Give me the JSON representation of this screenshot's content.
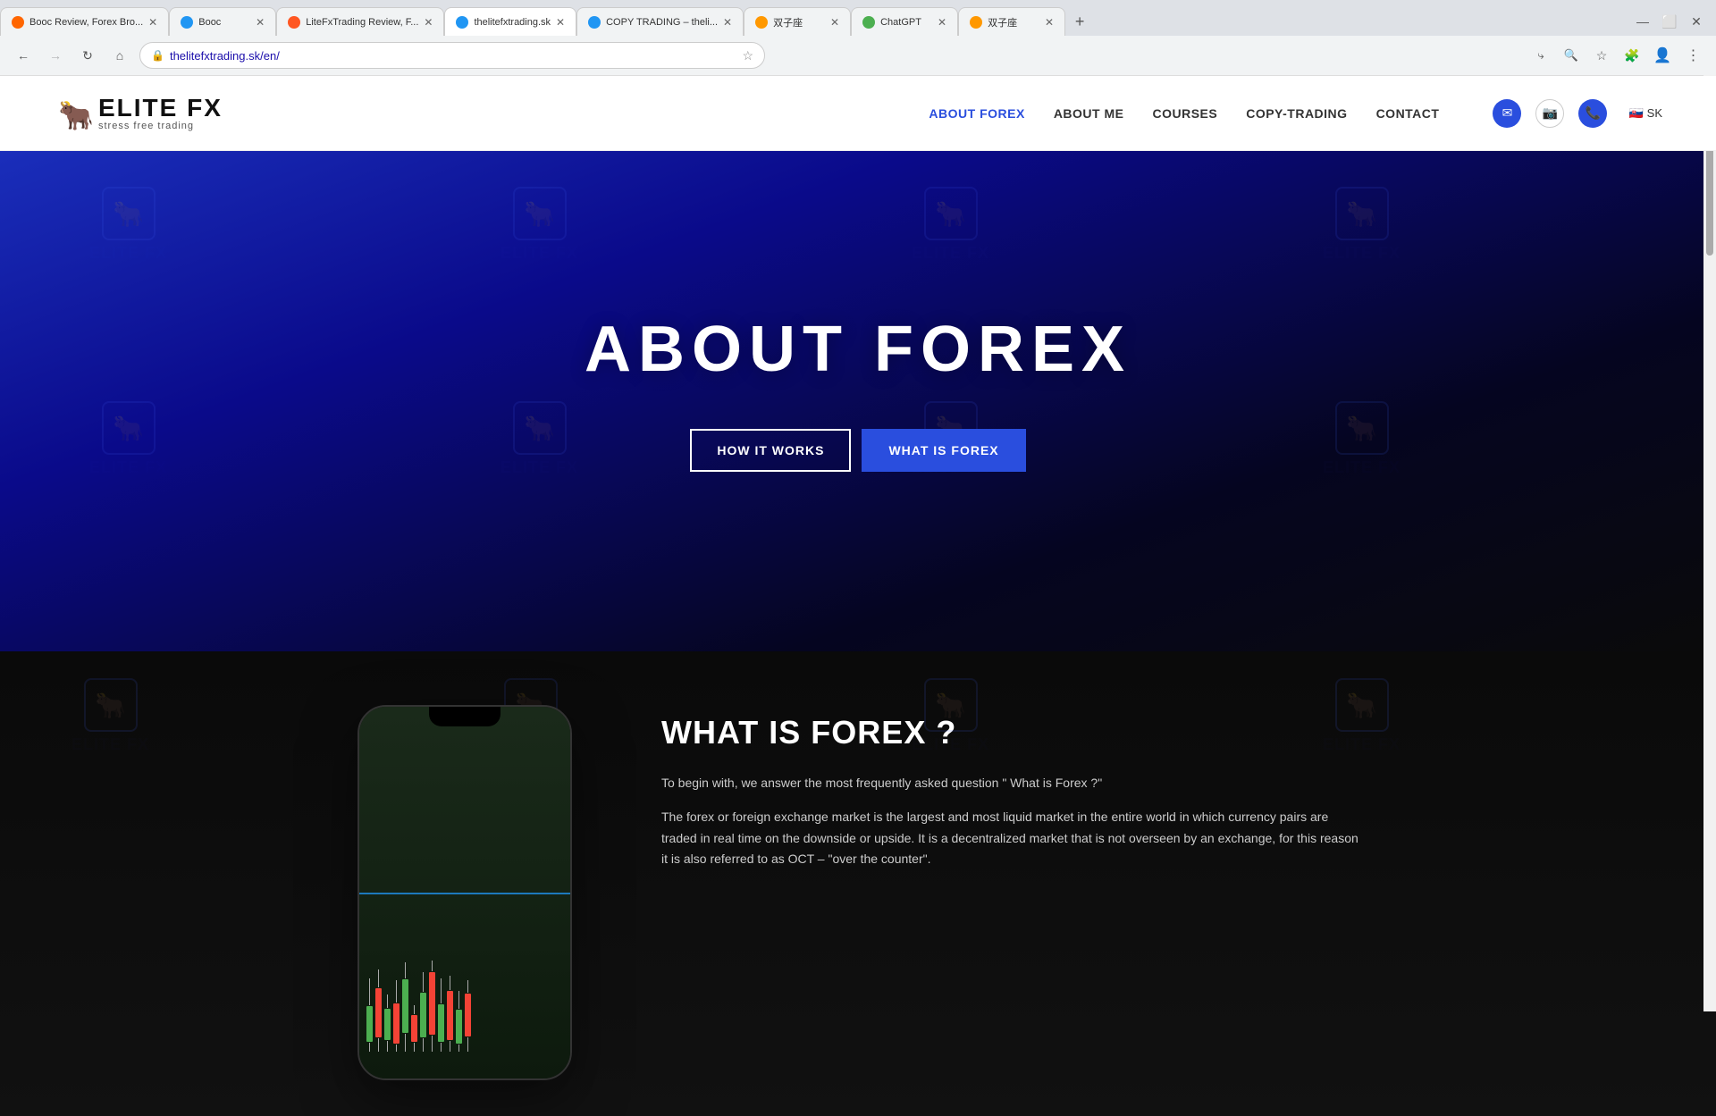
{
  "browser": {
    "tabs": [
      {
        "id": "tab1",
        "label": "Booc Review, Forex Bro...",
        "favicon_color": "#ff6600",
        "active": false
      },
      {
        "id": "tab2",
        "label": "Booc",
        "favicon_color": "#2196f3",
        "active": false
      },
      {
        "id": "tab3",
        "label": "LiteFxTrading Review, F...",
        "favicon_color": "#ff5722",
        "active": false
      },
      {
        "id": "tab4",
        "label": "thelitefxtrading.sk",
        "favicon_color": "#2196f3",
        "active": true
      },
      {
        "id": "tab5",
        "label": "COPY TRADING – theli...",
        "favicon_color": "#2196f3",
        "active": false
      },
      {
        "id": "tab6",
        "label": "双子座",
        "favicon_color": "#ff9800",
        "active": false
      },
      {
        "id": "tab7",
        "label": "ChatGPT",
        "favicon_color": "#4caf50",
        "active": false
      },
      {
        "id": "tab8",
        "label": "双子座",
        "favicon_color": "#ff9800",
        "active": false
      }
    ],
    "url": "thelitefxtrading.sk/en/",
    "nav": {
      "back": "←",
      "forward": "→",
      "refresh": "↻",
      "home": "⌂"
    }
  },
  "site": {
    "logo": {
      "bull_icon": "🐂",
      "title": "ELITE FX",
      "subtitle": "stress free trading"
    },
    "nav": {
      "links": [
        {
          "id": "about-forex",
          "label": "ABOUT FOREX",
          "active": true
        },
        {
          "id": "about-me",
          "label": "ABOUT ME",
          "active": false
        },
        {
          "id": "courses",
          "label": "COURSES",
          "active": false
        },
        {
          "id": "copy-trading",
          "label": "COPY-TRADING",
          "active": false
        },
        {
          "id": "contact",
          "label": "CONTACT",
          "active": false
        }
      ],
      "icons": {
        "email": "✉",
        "instagram": "📷",
        "phone": "📞"
      },
      "language": "SK",
      "flag": "🇸🇰"
    },
    "hero": {
      "title": "ABOUT FOREX",
      "btn_how": "HOW IT WORKS",
      "btn_what": "WHAT IS FOREX"
    },
    "content": {
      "section_title": "WHAT IS FOREX ?",
      "paragraph1": "To begin with, we answer the most frequently asked question \" What is Forex ?\"",
      "paragraph2": "The forex or foreign exchange market is the largest and most liquid market in the entire world in which currency pairs are traded in real time on the downside or upside. It is a decentralized market that is not overseen by an exchange, for this reason it is also referred to as OCT – \"over the counter\"."
    }
  }
}
